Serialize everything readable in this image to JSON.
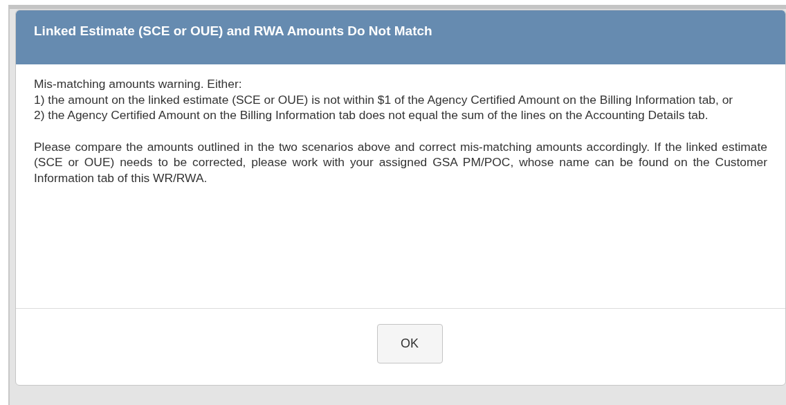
{
  "dialog": {
    "title": "Linked Estimate (SCE or OUE) and RWA Amounts Do Not Match",
    "paragraphs": [
      [
        "Mis-matching amounts warning. Either:",
        "1) the amount on the linked estimate (SCE or OUE) is not within $1 of the Agency Certified Amount on the Billing Information tab, or",
        "2) the Agency Certified Amount on the Billing Information tab does not equal the sum of the lines on the Accounting Details tab."
      ],
      [
        "Please compare the amounts outlined in the two scenarios above and correct mis-matching amounts accordingly. If the linked estimate (SCE or OUE) needs to be corrected, please work with your assigned GSA PM/POC, whose name can be found on the Customer Information tab of this WR/RWA."
      ]
    ],
    "buttons": [
      "OK"
    ]
  }
}
